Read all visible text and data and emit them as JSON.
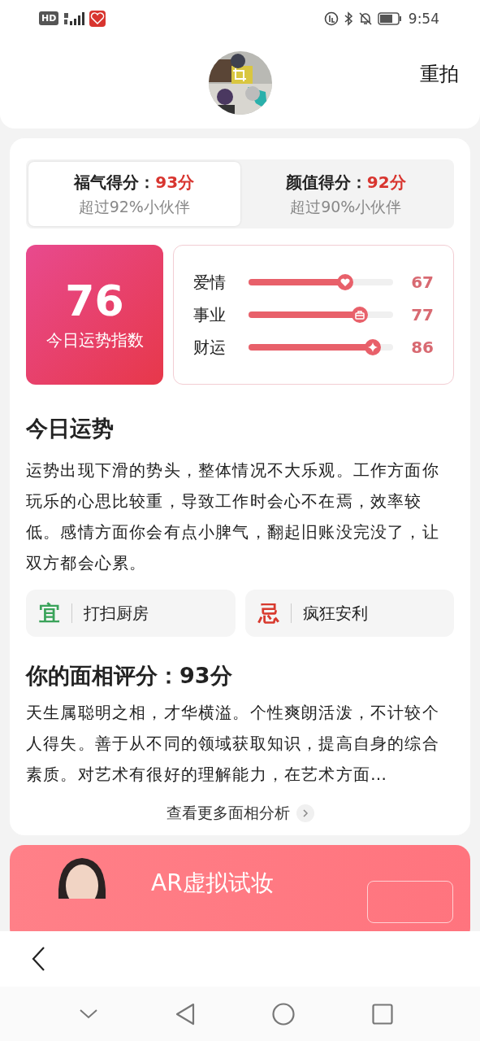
{
  "status_bar": {
    "time": "9:54",
    "network": "HD"
  },
  "header": {
    "retake": "重拍"
  },
  "score_tabs": [
    {
      "label": "福气得分：",
      "score": "93分",
      "note": "超过92%小伙伴",
      "selected": true
    },
    {
      "label": "颜值得分：",
      "score": "92分",
      "note": "超过90%小伙伴",
      "selected": false
    }
  ],
  "fortune_index": {
    "value": "76",
    "label": "今日运势指数"
  },
  "aspects": [
    {
      "name": "爱情",
      "kind": "heart",
      "level": 0.67,
      "reading": "67"
    },
    {
      "name": "事业",
      "kind": "bag",
      "level": 0.77,
      "reading": "77"
    },
    {
      "name": "财运",
      "kind": "star",
      "level": 0.86,
      "reading": "86"
    }
  ],
  "today": {
    "title": "今日运势",
    "text": "运势出现下滑的势头，整体情况不大乐观。工作方面你玩乐的心思比较重，导致工作时会心不在焉，效率较低。感情方面你会有点小脾气，翻起旧账没完没了，让双方都会心累。"
  },
  "advice": [
    {
      "tag": "宜",
      "color": "#3aa35a",
      "text": "打扫厨房"
    },
    {
      "tag": "忌",
      "color": "#d83a2e",
      "text": "疯狂安利"
    }
  ],
  "face": {
    "title": "你的面相评分：93分",
    "text": "天生属聪明之相，才华横溢。个性爽朗活泼，不计较个人得失。善于从不同的领域获取知识，提高自身的综合素质。对艺术有很好的理解能力，在艺术方面…",
    "more": "查看更多面相分析"
  },
  "banner": {
    "title": "AR虚拟试妆"
  }
}
